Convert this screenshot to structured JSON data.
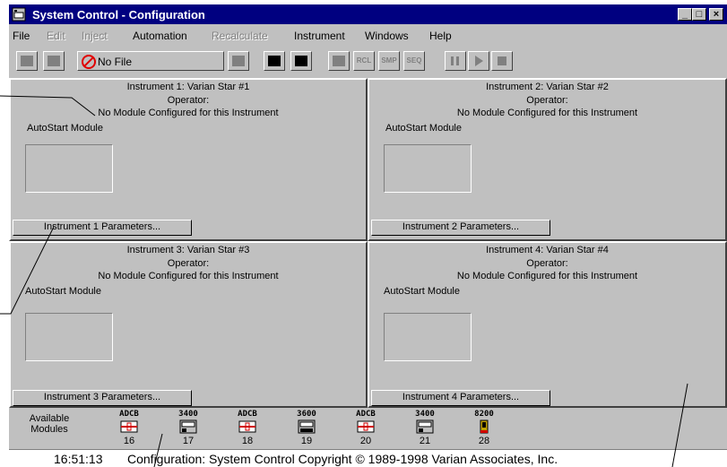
{
  "window": {
    "title": "System Control - Configuration"
  },
  "menu": [
    {
      "label": "File",
      "enabled": true
    },
    {
      "label": "Edit",
      "enabled": false
    },
    {
      "label": "Inject",
      "enabled": false
    },
    {
      "label": "Automation",
      "enabled": true
    },
    {
      "label": "Recalculate",
      "enabled": false
    },
    {
      "label": "Instrument",
      "enabled": true
    },
    {
      "label": "Windows",
      "enabled": true
    },
    {
      "label": "Help",
      "enabled": true
    }
  ],
  "toolbar": {
    "file_label": "No File",
    "rcl_label": "RCL",
    "smp_label": "SMP",
    "seq_label": "SEQ"
  },
  "instruments": [
    {
      "title": "Instrument 1: Varian Star #1",
      "operator": "Operator:",
      "status": "No Module Configured for this Instrument",
      "autostart": "AutoStart Module",
      "button": "Instrument 1 Parameters..."
    },
    {
      "title": "Instrument 2: Varian Star #2",
      "operator": "Operator:",
      "status": "No Module Configured for this Instrument",
      "autostart": "AutoStart Module",
      "button": "Instrument 2 Parameters..."
    },
    {
      "title": "Instrument 3: Varian Star #3",
      "operator": "Operator:",
      "status": "No Module Configured for this Instrument",
      "autostart": "AutoStart Module",
      "button": "Instrument 3 Parameters..."
    },
    {
      "title": "Instrument 4: Varian Star #4",
      "operator": "Operator:",
      "status": "No Module Configured for this Instrument",
      "autostart": "AutoStart Module",
      "button": "Instrument 4 Parameters..."
    }
  ],
  "modules": {
    "label_line1": "Available",
    "label_line2": "Modules",
    "items": [
      {
        "name": "ADCB",
        "number": "16",
        "icon": "adc-board-icon"
      },
      {
        "name": "3400",
        "number": "17",
        "icon": "gc-3400-icon"
      },
      {
        "name": "ADCB",
        "number": "18",
        "icon": "adc-board-icon"
      },
      {
        "name": "3600",
        "number": "19",
        "icon": "gc-3600-icon"
      },
      {
        "name": "ADCB",
        "number": "20",
        "icon": "adc-board-icon"
      },
      {
        "name": "3400",
        "number": "21",
        "icon": "gc-3400-icon"
      },
      {
        "name": "8200",
        "number": "28",
        "icon": "autosampler-8200-icon"
      }
    ]
  },
  "status": {
    "time": "16:51:13",
    "message": "Configuration: System Control Copyright © 1989-1998 Varian Associates, Inc."
  },
  "colors": {
    "titlebar": "#000080",
    "face": "#c0c0c0",
    "no_file": "#e00000",
    "adcb_red": "#d00000"
  }
}
